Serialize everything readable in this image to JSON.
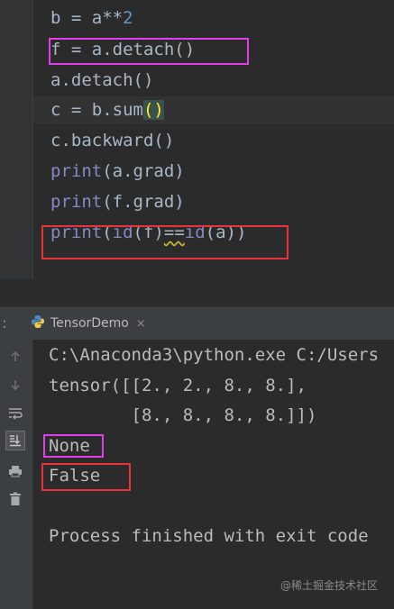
{
  "editor": {
    "lines": {
      "l1": {
        "pre": "b = a**",
        "num": "2"
      },
      "l2": "f = a.detach()",
      "l3": "a.detach()",
      "l4": {
        "pre": "c = b.sum",
        "paren": "()"
      },
      "l5": "c.backward()",
      "l6": {
        "fn": "print",
        "rest": "(a.grad)"
      },
      "l7": {
        "fn": "print",
        "rest": "(f.grad)"
      },
      "l8": {
        "fn": "print",
        "open": "(",
        "id1": "id",
        "arg1": "(f)",
        "op": "==",
        "id2": "id",
        "arg2": "(a))"
      }
    }
  },
  "run_panel": {
    "tab_label": "TensorDemo",
    "tab_close": "×",
    "console": [
      "C:\\Anaconda3\\python.exe C:/Users",
      "tensor([[2., 2., 8., 8.],",
      "        [8., 8., 8., 8.]])",
      "None",
      "False",
      "",
      "Process finished with exit code"
    ]
  },
  "watermark": "@稀土掘金技术社区",
  "colors": {
    "highlight_pink": "#e040e8",
    "highlight_red": "#e8333f",
    "builtin": "#8888c6",
    "number": "#6897bb"
  },
  "icons": [
    "up-arrow-icon",
    "down-arrow-icon",
    "soft-wrap-icon",
    "scroll-to-end-icon",
    "print-icon",
    "trash-icon",
    "python-icon"
  ]
}
